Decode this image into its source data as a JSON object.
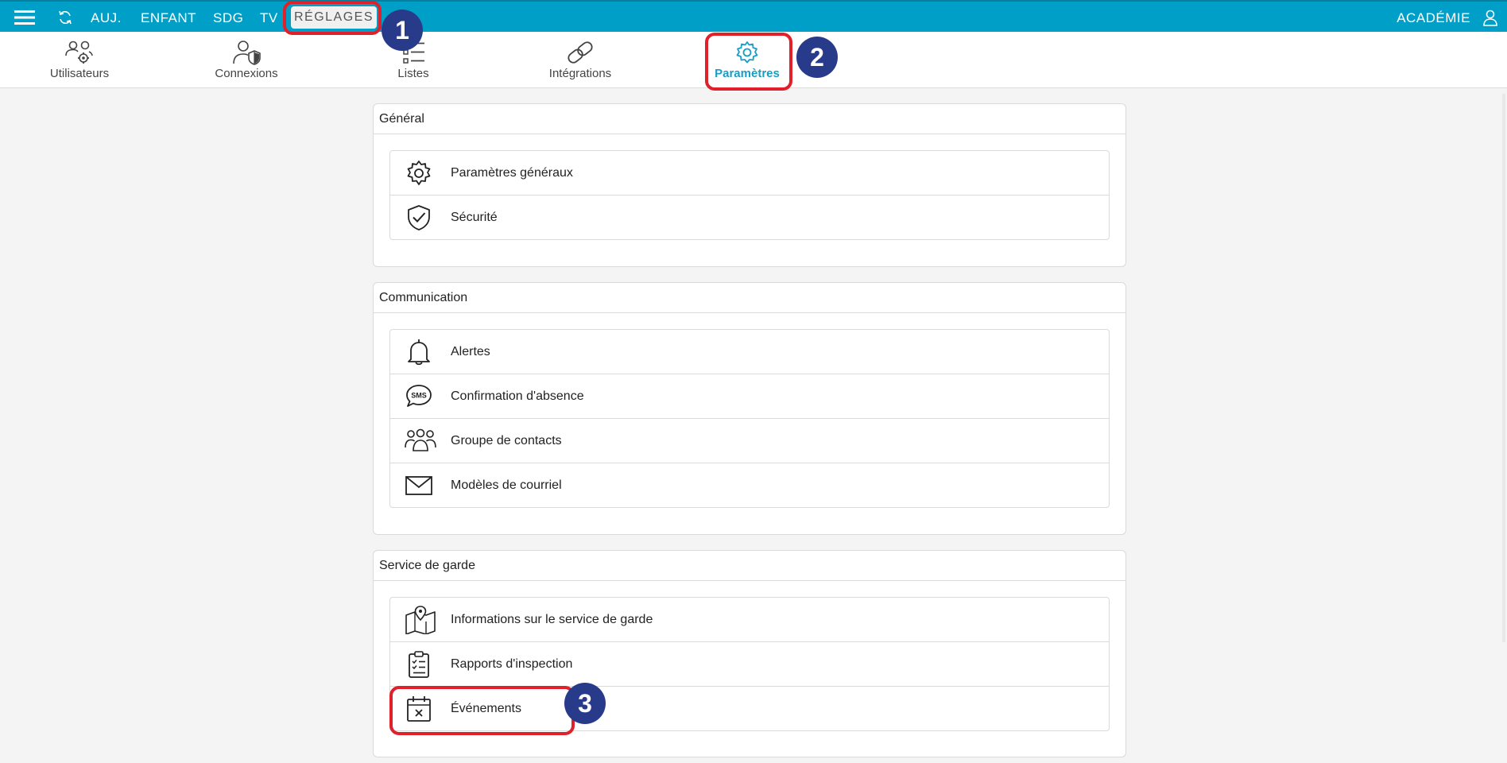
{
  "topbar": {
    "nav": [
      "AUJ.",
      "ENFANT",
      "SDG",
      "TV"
    ],
    "active": "RÉGLAGES",
    "right_label": "ACADÉMIE"
  },
  "subnav": {
    "tabs": [
      {
        "label": "Utilisateurs",
        "icon": "users-gear-icon"
      },
      {
        "label": "Connexions",
        "icon": "user-shield-icon"
      },
      {
        "label": "Listes",
        "icon": "list-icon"
      },
      {
        "label": "Intégrations",
        "icon": "link-icon"
      },
      {
        "label": "Paramètres",
        "icon": "gear-icon",
        "active": true
      }
    ]
  },
  "sections": [
    {
      "title": "Général",
      "items": [
        {
          "label": "Paramètres généraux",
          "icon": "gear-icon"
        },
        {
          "label": "Sécurité",
          "icon": "shield-check-icon"
        }
      ]
    },
    {
      "title": "Communication",
      "items": [
        {
          "label": "Alertes",
          "icon": "bell-icon"
        },
        {
          "label": "Confirmation d'absence",
          "icon": "sms-bubble-icon"
        },
        {
          "label": "Groupe de contacts",
          "icon": "group-icon"
        },
        {
          "label": "Modèles de courriel",
          "icon": "envelope-icon"
        }
      ]
    },
    {
      "title": "Service de garde",
      "items": [
        {
          "label": "Informations sur le service de garde",
          "icon": "map-pin-icon"
        },
        {
          "label": "Rapports d'inspection",
          "icon": "clipboard-checklist-icon"
        },
        {
          "label": "Événements",
          "icon": "calendar-x-icon"
        }
      ]
    }
  ],
  "annotations": [
    "1",
    "2",
    "3"
  ],
  "colors": {
    "topbar": "#009fc7",
    "accent": "#1a9cc4",
    "callout": "#e0202b",
    "badge": "#283a8a"
  }
}
